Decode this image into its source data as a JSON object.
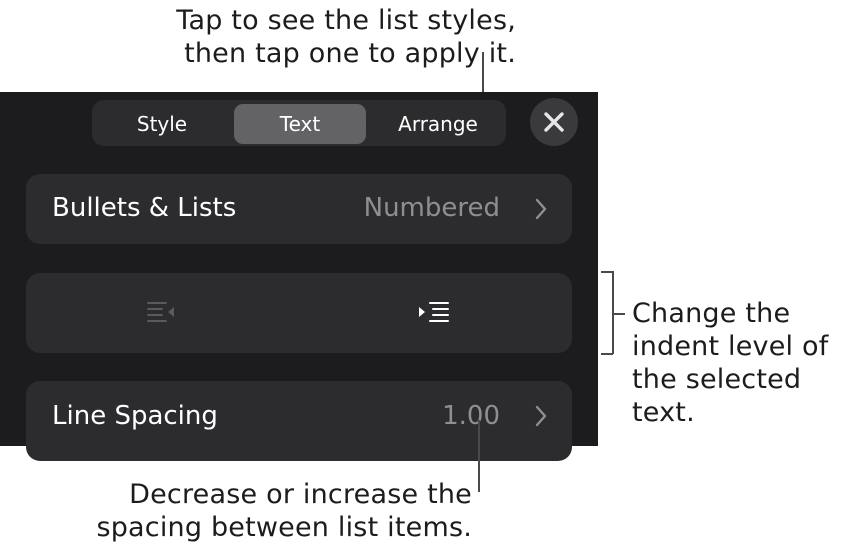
{
  "callouts": {
    "list_styles_line1": "Tap to see the list styles,",
    "list_styles_line2": "then tap one to apply it.",
    "indent_line1": "Change the",
    "indent_line2": "indent level of",
    "indent_line3": "the selected text.",
    "spacing_line1": "Decrease or increase the",
    "spacing_line2": "spacing between list items."
  },
  "tabs": [
    {
      "label": "Style",
      "active": false
    },
    {
      "label": "Text",
      "active": true
    },
    {
      "label": "Arrange",
      "active": false
    }
  ],
  "close_icon": "close-icon",
  "bullets": {
    "label": "Bullets & Lists",
    "value": "Numbered",
    "icon": "chevron-right-icon"
  },
  "indent": {
    "decrease_icon": "decrease-indent-icon",
    "increase_icon": "increase-indent-icon",
    "decrease_enabled": false,
    "increase_enabled": true
  },
  "line_spacing": {
    "label": "Line Spacing",
    "value": "1.00",
    "icon": "chevron-right-icon"
  },
  "colors": {
    "panel": "#1c1c1e",
    "row": "#2c2c2e",
    "active_tab": "#636366",
    "secondary_text": "#8e8e93"
  }
}
